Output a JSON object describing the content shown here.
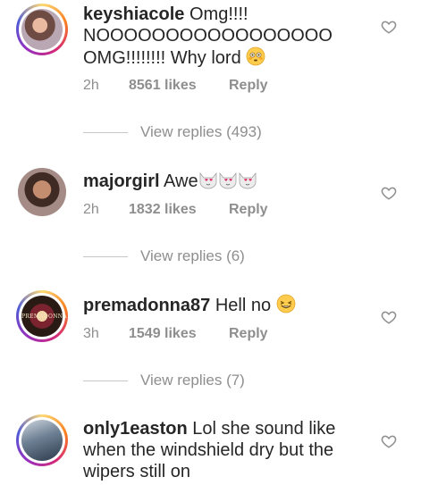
{
  "comments": [
    {
      "username": "keyshiacole",
      "text": "Omg!!!! NOOOOOOOOOOOOOOOOO OMG!!!!!!!! Why lord",
      "emoji": "flushed-face",
      "time": "2h",
      "likes": "8561 likes",
      "reply": "Reply",
      "view_replies": "View replies (493)"
    },
    {
      "username": "majorgirl",
      "text": "Awe",
      "emoji": "heart-eyes-cat x3",
      "time": "2h",
      "likes": "1832 likes",
      "reply": "Reply",
      "view_replies": "View replies (6)"
    },
    {
      "username": "premadonna87",
      "text": "Hell no",
      "emoji": "laughing-face",
      "avatar_text": "PREMADONNA",
      "time": "3h",
      "likes": "1549 likes",
      "reply": "Reply",
      "view_replies": "View replies (7)"
    },
    {
      "username": "only1easton",
      "text": "Lol she sound like when the windshield dry but the wipers still on"
    }
  ]
}
